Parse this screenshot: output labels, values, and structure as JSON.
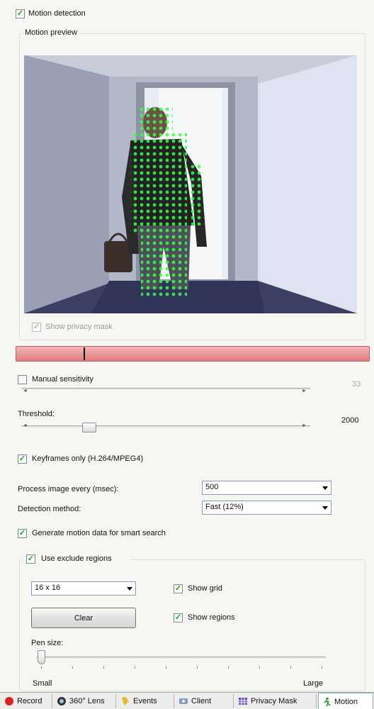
{
  "motion_detection": {
    "label": "Motion detection",
    "checked": true
  },
  "motion_preview": {
    "title": "Motion preview",
    "show_privacy_mask": {
      "label": "Show privacy mask",
      "checked": true,
      "enabled": false
    }
  },
  "level_bar": {
    "color": "#e8868a",
    "marker_fraction": 0.19
  },
  "manual_sensitivity": {
    "label": "Manual sensitivity",
    "checked": false,
    "value": "33"
  },
  "threshold": {
    "label": "Threshold:",
    "value": "2000",
    "slider_fraction": 0.2
  },
  "keyframes_only": {
    "label": "Keyframes only (H.264/MPEG4)",
    "checked": true
  },
  "process_image": {
    "label": "Process image every (msec):",
    "selected": "500"
  },
  "detection_method": {
    "label": "Detection method:",
    "selected": "Fast (12%)"
  },
  "smart_search": {
    "label": "Generate motion data for smart search",
    "checked": true
  },
  "exclude_regions": {
    "label": "Use exclude regions",
    "checked": true,
    "grid_size": "16 x 16",
    "clear_label": "Clear",
    "show_grid": {
      "label": "Show grid",
      "checked": true
    },
    "show_regions": {
      "label": "Show regions",
      "checked": true
    },
    "pen_size": {
      "label": "Pen size:",
      "min_label": "Small",
      "max_label": "Large",
      "slider_fraction": 0.0
    }
  },
  "tabs": [
    {
      "label": "Record",
      "icon": "record-icon",
      "active": false
    },
    {
      "label": "360° Lens",
      "icon": "lens-icon",
      "active": false
    },
    {
      "label": "Events",
      "icon": "events-icon",
      "active": false
    },
    {
      "label": "Client",
      "icon": "client-icon",
      "active": false
    },
    {
      "label": "Privacy Mask",
      "icon": "privacy-mask-icon",
      "active": false
    },
    {
      "label": "Motion",
      "icon": "motion-icon",
      "active": true
    }
  ]
}
